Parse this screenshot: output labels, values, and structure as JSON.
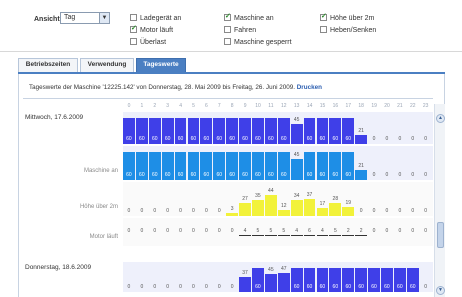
{
  "filters": {
    "ansicht_label": "Ansicht",
    "ansicht_value": "Tag",
    "checkboxes": [
      {
        "label": "Ladegerät an",
        "checked": false
      },
      {
        "label": "Motor läuft",
        "checked": true
      },
      {
        "label": "Überlast",
        "checked": false
      },
      {
        "label": "Maschine an",
        "checked": true
      },
      {
        "label": "Fahren",
        "checked": false
      },
      {
        "label": "Maschine gesperrt",
        "checked": false
      },
      {
        "label": "Höhe über 2m",
        "checked": true
      },
      {
        "label": "Heben/Senken",
        "checked": false
      }
    ]
  },
  "tabs": [
    {
      "label": "Betriebszeiten",
      "active": false
    },
    {
      "label": "Verwendung",
      "active": false
    },
    {
      "label": "Tageswerte",
      "active": true
    }
  ],
  "info": {
    "text": "Tageswerte der Maschine '12225.142' von Donnerstag, 28. Mai 2009 bis Freitag, 26. Juni 2009.",
    "link": "Drucken"
  },
  "hours": [
    "0",
    "1",
    "2",
    "3",
    "4",
    "5",
    "6",
    "7",
    "8",
    "9",
    "10",
    "11",
    "12",
    "13",
    "14",
    "15",
    "16",
    "17",
    "18",
    "19",
    "20",
    "21",
    "22",
    "23"
  ],
  "days": [
    {
      "label": "Mittwoch, 17.6.2009",
      "rows": [
        {
          "name": "Motor läuft",
          "label": "",
          "color": "#3f3fe8",
          "type": "block",
          "values": [
            "60",
            "60",
            "60",
            "60",
            "60",
            "60",
            "60",
            "60",
            "60",
            "60",
            "60",
            "60",
            "60",
            "45",
            "60",
            "60",
            "60",
            "60",
            "21",
            "0",
            "0",
            "0",
            "0",
            "0"
          ]
        },
        {
          "name": "Maschine an",
          "label": "Maschine an",
          "color": "#1e8ee6",
          "type": "block",
          "values": [
            "60",
            "60",
            "60",
            "60",
            "60",
            "60",
            "60",
            "60",
            "60",
            "60",
            "60",
            "60",
            "60",
            "45",
            "60",
            "60",
            "60",
            "60",
            "21",
            "0",
            "0",
            "0",
            "0",
            "0"
          ]
        },
        {
          "name": "Höhe über 2m",
          "label": "Höhe über 2m",
          "color": "#f2f23a",
          "type": "bars",
          "values": [
            "0",
            "0",
            "0",
            "0",
            "0",
            "0",
            "0",
            "0",
            "3",
            "27",
            "35",
            "44",
            "12",
            "34",
            "37",
            "17",
            "28",
            "19",
            "0",
            "0",
            "0",
            "0",
            "0",
            "0"
          ]
        },
        {
          "name": "Motor läuft (detail)",
          "label": "Motor läuft",
          "color": "#555555",
          "type": "small",
          "values": [
            "0",
            "0",
            "0",
            "0",
            "0",
            "0",
            "0",
            "0",
            "0",
            "4",
            "5",
            "5",
            "5",
            "4",
            "6",
            "4",
            "5",
            "2",
            "2",
            "0",
            "0",
            "0",
            "0",
            "0"
          ]
        }
      ]
    },
    {
      "label": "Donnerstag, 18.6.2009",
      "rows": [
        {
          "name": "Motor läuft",
          "label": "",
          "color": "#3f3fe8",
          "type": "block",
          "values": [
            "0",
            "0",
            "0",
            "0",
            "0",
            "0",
            "0",
            "0",
            "0",
            "37",
            "60",
            "45",
            "47",
            "60",
            "60",
            "60",
            "60",
            "60",
            "60",
            "60",
            "60",
            "60",
            "60",
            "0"
          ]
        }
      ]
    }
  ]
}
